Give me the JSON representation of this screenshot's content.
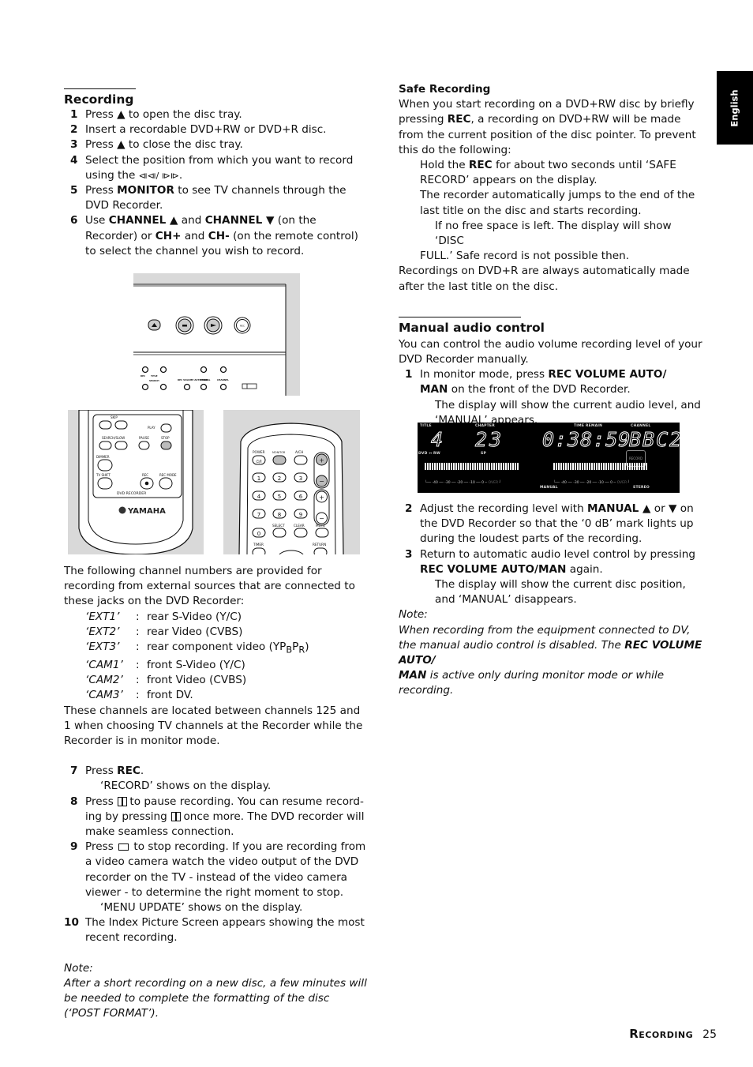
{
  "language_tab": "English",
  "left": {
    "title": "Recording",
    "steps_a": [
      {
        "n": "1",
        "parts": [
          "Press ",
          "▲",
          " to open the disc tray."
        ]
      },
      {
        "n": "2",
        "text": "Insert a recordable DVD+RW or DVD+R disc."
      },
      {
        "n": "3",
        "parts": [
          "Press ",
          "▲",
          " to close the disc tray."
        ]
      },
      {
        "n": "4",
        "line1": "Select the position from which you want to record",
        "line2_pre": "using the ",
        "line2_icon": "⧏⧏/ ⧐⧐",
        "line2_post": "."
      },
      {
        "n": "5",
        "pre": "Press ",
        "bold": "MONITOR",
        "post": " to see TV channels through the DVD Recorder."
      },
      {
        "n": "6",
        "pre": "Use ",
        "b1": "CHANNEL ▲",
        "mid1": " and ",
        "b2": "CHANNEL ▼",
        "mid2": " (on the Recorder) or ",
        "b3": "CH+",
        "mid3": " and ",
        "b4": "CH-",
        "post": " (on the remote control) to select the channel you wish to record."
      }
    ],
    "figure_front_panel": {
      "labels": [
        "REC",
        "TITLE",
        "SEARCH",
        "REC VOLUME AUTO/MAN",
        "MANUAL",
        "CHANNEL"
      ]
    },
    "figure_remote_left": {
      "labels": {
        "skip": "SKIP",
        "play": "PLAY",
        "search": "SEARCH/SLOW",
        "pause": "PAUSE",
        "stop": "STOP",
        "dimmer": "DIMMER",
        "tvshift": "TV SHIFT",
        "rec": "REC",
        "recmode": "REC MODE",
        "panel": "DVD RECORDER",
        "brand": "YAMAHA"
      }
    },
    "figure_remote_right": {
      "labels": {
        "power": "POWER",
        "monitor": "MONITOR",
        "ach": "A/CH",
        "ch": "CH",
        "vol": "VOL",
        "select": "SELECT",
        "clear": "CLEAR",
        "mute": "MUTE",
        "timer": "TIMER",
        "return": "RETURN"
      },
      "digits": [
        "1",
        "2",
        "3",
        "4",
        "5",
        "6",
        "7",
        "8",
        "9",
        "0"
      ]
    },
    "jacks_intro": "The following channel numbers are provided for recording from external sources that are connected to these jacks on the DVD Recorder:",
    "jacks": [
      {
        "name": "‘EXT1’",
        "desc": "rear S-Video (Y/C)"
      },
      {
        "name": "‘EXT2’",
        "desc": "rear Video (CVBS)"
      },
      {
        "name": "‘EXT3’",
        "desc": "rear component video (YP",
        "sub1": "B",
        "mid": "P",
        "sub2": "R",
        "end": ")"
      },
      {
        "name": "‘CAM1’",
        "desc": "front S-Video (Y/C)"
      },
      {
        "name": "‘CAM2’",
        "desc": "front Video (CVBS)"
      },
      {
        "name": "‘CAM3’",
        "desc": "front DV."
      }
    ],
    "jacks_outro": "These channels are located between channels 125 and 1 when choosing TV channels at the Recorder while the Recorder is in monitor mode.",
    "steps_b": {
      "s7": {
        "n": "7",
        "pre": "Press ",
        "bold": "REC",
        "post": ".",
        "sub": "‘RECORD’ shows on the display."
      },
      "s8": {
        "n": "8",
        "pre": "Press ",
        "mid": " to pause recording. You can resume record-ing by pressing ",
        "post": " once more. The DVD recorder will make seamless connection."
      },
      "s9": {
        "n": "9",
        "pre": "Press ",
        "post": " to stop recording. If you are recording from a video camera watch the video output of the DVD recorder on the TV - instead of the video camera viewer - to determine the right moment to stop.",
        "sub": "‘MENU UPDATE’ shows on the display."
      },
      "s10": {
        "n": "10",
        "text": "The Index Picture Screen appears showing the most recent recording."
      }
    },
    "note_label": "Note:",
    "note_text": "After a short recording on a new disc, a few minutes will be needed to complete the formatting of the disc (‘POST FORMAT’)."
  },
  "right": {
    "safe_title": "Safe Recording",
    "safe_p1_pre": "When you start recording on a DVD+RW disc by briefly pressing ",
    "safe_p1_bold": "REC",
    "safe_p1_post": ", a recording on DVD+RW will be made from the current position of the disc pointer. To prevent this do the following:",
    "safe_hold_pre": "Hold the ",
    "safe_hold_bold": "REC",
    "safe_hold_post": " for about two seconds until ‘SAFE RECORD’ appears on the display.",
    "safe_jump": "The recorder automatically jumps to the end of the last title on the disc and starts recording.",
    "safe_full_1": "If no free space is left. The display will show ‘DISC",
    "safe_full_2": "FULL.’ Safe record is not possible then.",
    "safe_p2": "Recordings on DVD+R are always automatically made after the last title on the disc.",
    "manual_title": "Manual audio control",
    "manual_intro": "You can control the audio volume recording level of your DVD Recorder manually.",
    "m1": {
      "n": "1",
      "pre": "In monitor mode, press ",
      "bold1": "REC VOLUME AUTO/",
      "bold2": "MAN",
      "post": " on the front of the DVD Recorder.",
      "sub": "The display will show the current audio level, and ‘MANUAL’ appears."
    },
    "display": {
      "title_label": "TITLE",
      "title_value": "4",
      "chapter_label": "CHAPTER",
      "chapter_value": "23",
      "time_label": "TIME",
      "remain_label": "REMAIN",
      "time_value": "0:38:59",
      "channel_label": "CHANNEL",
      "channel_value": "BBC2",
      "disc_label": "DVD ↔ RW",
      "mode_label": "SP",
      "record_badge": "RECORD",
      "manual_label": "MANUAL",
      "stereo_label": "STEREO",
      "scale": [
        "-40",
        "-30",
        "-20",
        "-10",
        "0",
        "OVER"
      ]
    },
    "m2": {
      "n": "2",
      "pre": "Adjust the recording level with ",
      "bold": "MANUAL ▲",
      "mid": " or ",
      "bold2": "▼",
      "post": " on the DVD Recorder so that the ‘0 dB’ mark lights up during the loudest parts of the recording."
    },
    "m3": {
      "n": "3",
      "pre": "Return to automatic audio level control by pressing ",
      "bold": "REC VOLUME AUTO/MAN",
      "post": " again.",
      "sub": "The display will show the current disc position, and ‘MANUAL’ disappears."
    },
    "note_label": "Note:",
    "note_pre": "When recording from the equipment connected to DV, the manual audio control is disabled. The ",
    "note_bold1": "REC VOLUME AUTO/",
    "note_bold2": "MAN",
    "note_post": " is active only during monitor mode or while recording."
  },
  "footer": {
    "section": "Recording",
    "page": "25"
  }
}
